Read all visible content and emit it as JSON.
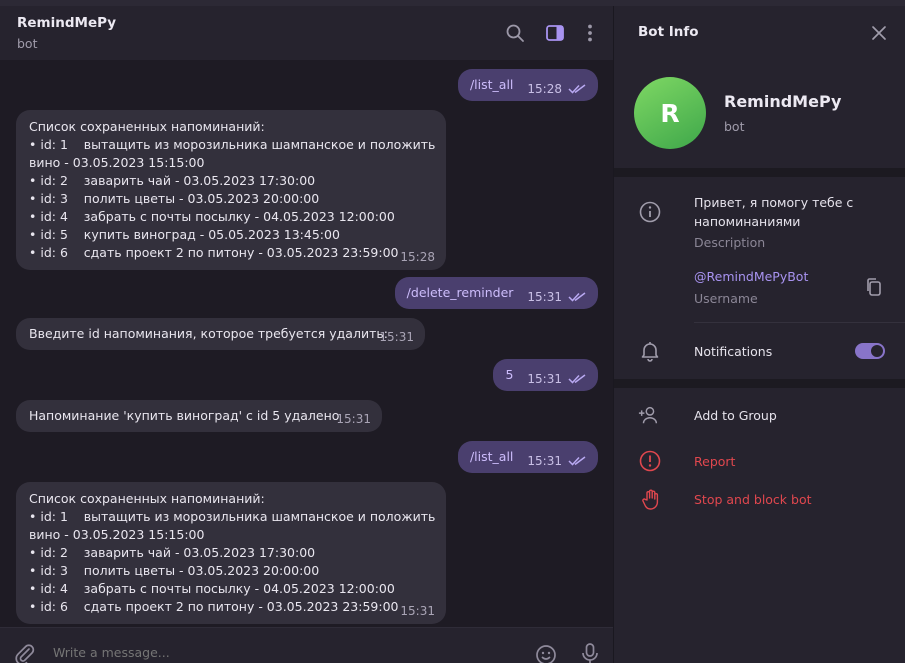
{
  "chat": {
    "title": "RemindMePy",
    "subtitle": "bot",
    "messages": [
      {
        "type": "out",
        "text": "/list_all",
        "time": "15:28"
      },
      {
        "type": "in",
        "lines": [
          "Список сохраненных напоминаний:",
          "• id: 1    вытащить из морозильника шампанское и положить",
          "вино - 03.05.2023 15:15:00",
          "• id: 2    заварить чай - 03.05.2023 17:30:00",
          "• id: 3    полить цветы - 03.05.2023 20:00:00",
          "• id: 4    забрать с почты посылку - 04.05.2023 12:00:00",
          "• id: 5    купить виноград - 05.05.2023 13:45:00",
          "• id: 6    сдать проект 2 по питону - 03.05.2023 23:59:00"
        ],
        "time": "15:28"
      },
      {
        "type": "out",
        "text": "/delete_reminder",
        "time": "15:31"
      },
      {
        "type": "in",
        "lines": [
          "Введите id напоминания, которое требуется удалить:"
        ],
        "time": "15:31"
      },
      {
        "type": "out",
        "text": "5",
        "time": "15:31"
      },
      {
        "type": "in",
        "lines": [
          "Напоминание 'купить виноград' с id 5 удалено"
        ],
        "time": "15:31"
      },
      {
        "type": "out",
        "text": "/list_all",
        "time": "15:31"
      },
      {
        "type": "in",
        "lines": [
          "Список сохраненных напоминаний:",
          "• id: 1    вытащить из морозильника шампанское и положить",
          "вино - 03.05.2023 15:15:00",
          "• id: 2    заварить чай - 03.05.2023 17:30:00",
          "• id: 3    полить цветы - 03.05.2023 20:00:00",
          "• id: 4    забрать с почты посылку - 04.05.2023 12:00:00",
          "• id: 6    сдать проект 2 по питону - 03.05.2023 23:59:00"
        ],
        "time": "15:31"
      }
    ],
    "composer_placeholder": "Write a message..."
  },
  "panel": {
    "title": "Bot Info",
    "avatar_letter": "R",
    "name": "RemindMePy",
    "subtitle": "bot",
    "description_line1": "Привет, я помогу тебе с",
    "description_line2": "напоминаниями",
    "description_label": "Description",
    "username": "@RemindMePyBot",
    "username_label": "Username",
    "notifications_label": "Notifications",
    "notifications_on": true,
    "add_to_group": "Add to Group",
    "report": "Report",
    "stop_block": "Stop and block bot"
  },
  "colors": {
    "accent": "#8874c9",
    "outgoing_bubble": "#4a3f6e",
    "incoming_bubble": "#33303c",
    "danger": "#e0474e",
    "avatar_green": "#4cb551"
  },
  "icons": [
    "search-icon",
    "sidebar-toggle-icon",
    "more-vertical-icon",
    "close-icon",
    "info-icon",
    "copy-icon",
    "bell-icon",
    "add-user-icon",
    "report-icon",
    "hand-stop-icon",
    "paperclip-icon",
    "emoji-icon",
    "microphone-icon"
  ]
}
